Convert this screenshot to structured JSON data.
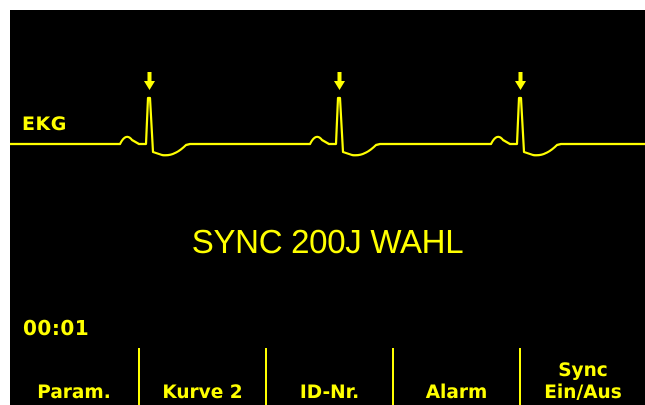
{
  "colors": {
    "background": "#000000",
    "foreground": "#FFFF00"
  },
  "lead": {
    "label": "EKG"
  },
  "sync_marker_icon": "down-arrow-icon",
  "message": "SYNC 200J WAHL",
  "timer": "00:01",
  "softkeys": [
    {
      "label": "Param."
    },
    {
      "label": "Kurve 2"
    },
    {
      "label": "ID-Nr."
    },
    {
      "label": "Alarm"
    },
    {
      "label_line1": "Sync",
      "label_line2": "Ein/Aus"
    }
  ]
}
